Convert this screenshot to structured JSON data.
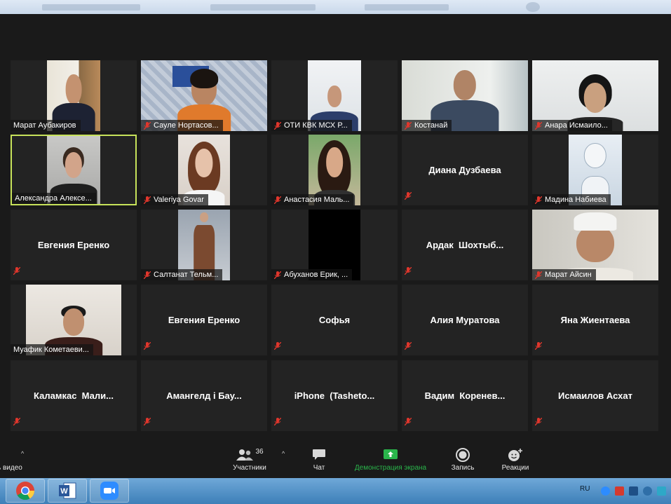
{
  "toolbar": {
    "video_label": "ь видео",
    "participants_label": "Участники",
    "participants_count": "36",
    "chat_label": "Чат",
    "share_label": "Демонстрация экрана",
    "record_label": "Запись",
    "reactions_label": "Реакции"
  },
  "taskbar": {
    "lang": "RU"
  },
  "tiles": [
    {
      "name": "Марат Аубакиров"
    },
    {
      "name": "Сауле Нортасов..."
    },
    {
      "name": "ОТИ КВК МСХ Р..."
    },
    {
      "name": "Костанай"
    },
    {
      "name": "Анара Исмаило..."
    },
    {
      "name": "Александра Алексе..."
    },
    {
      "name": "Valeriya Govar"
    },
    {
      "name": "Анастасия Маль..."
    },
    {
      "name": "Диана Дузбаева"
    },
    {
      "name": "Мадина Набиева"
    },
    {
      "name": "Евгения Еренко"
    },
    {
      "name": "Салтанат Тельм..."
    },
    {
      "name": "Абуханов Ерик, ..."
    },
    {
      "name": "Ардак  Шохтыб..."
    },
    {
      "name": "Марат Айсин"
    },
    {
      "name": "Муафик Кометаеви..."
    },
    {
      "name": "Евгения Еренко"
    },
    {
      "name": "Софья"
    },
    {
      "name": "Алия Муратова"
    },
    {
      "name": "Яна Жиентаева"
    },
    {
      "name": "Каламкас  Мали..."
    },
    {
      "name": "Амангелд і Бау..."
    },
    {
      "name": "iPhone  (Tasheto..."
    },
    {
      "name": "Вадим  Коренев..."
    },
    {
      "name": "Исмаилов Асхат"
    }
  ],
  "colors": {
    "active_speaker": "#c7e25a",
    "share_green": "#2ab54b",
    "mute_red": "#e0362c"
  }
}
